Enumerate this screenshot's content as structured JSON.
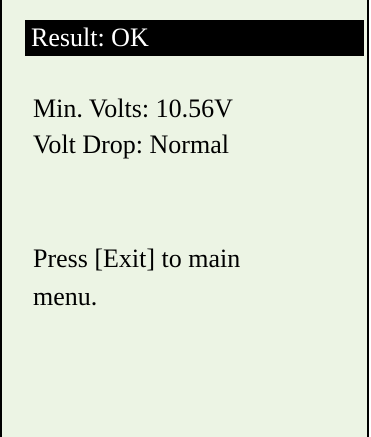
{
  "screen": {
    "title": "Result: OK",
    "min_volts": "Min. Volts: 10.56V",
    "volt_drop": "Volt Drop: Normal",
    "instruction_line1": "Press [Exit] to main",
    "instruction_line2": "menu."
  },
  "colors": {
    "background": "#ecf4e4",
    "title_bar": "#000000",
    "title_text": "#ffffff",
    "text": "#000000"
  }
}
